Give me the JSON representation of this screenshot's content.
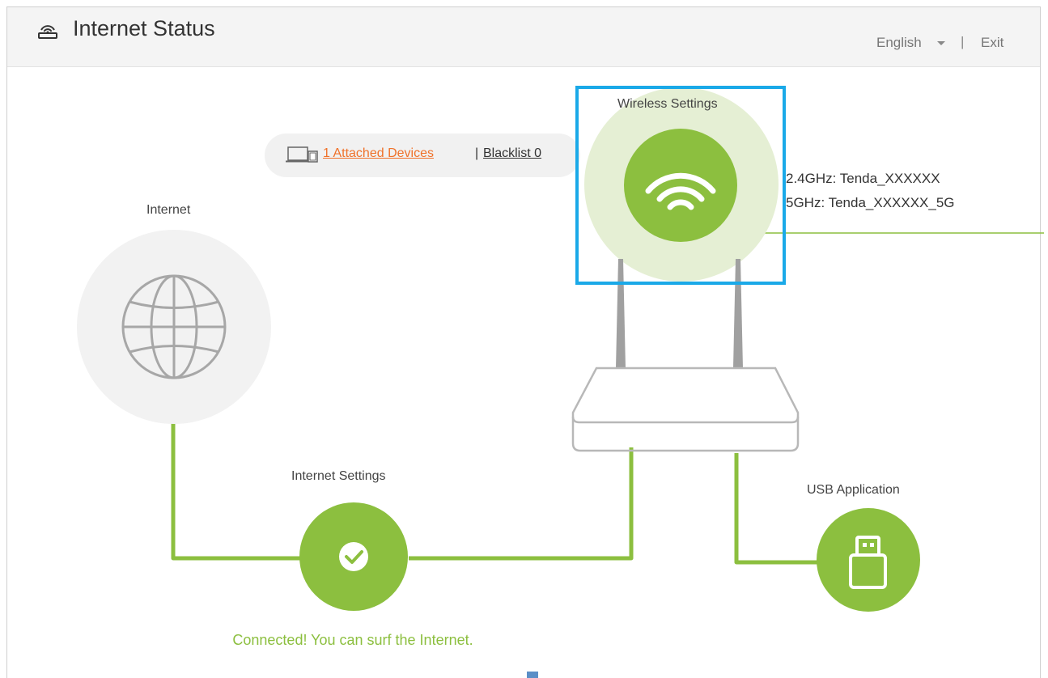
{
  "header": {
    "title": "Internet Status",
    "title_icon": "router-icon",
    "language": "English",
    "separator": "|",
    "exit": "Exit"
  },
  "internet": {
    "label": "Internet",
    "icon": "globe-icon"
  },
  "devices": {
    "attached_link": "1 Attached Devices ",
    "separator": "|",
    "blacklist_link": "Blacklist 0",
    "icon": "devices-icon"
  },
  "wireless": {
    "label": "Wireless Settings",
    "icon": "wifi-icon",
    "ssid_24": "2.4GHz: Tenda_XXXXXX",
    "ssid_5": "5GHz: Tenda_XXXXXX_5G"
  },
  "internet_settings": {
    "label": "Internet Settings",
    "icon": "check-icon",
    "status": "Connected! You can surf the Internet."
  },
  "usb": {
    "label": "USB Application",
    "icon": "usb-drive-icon"
  },
  "colors": {
    "accent_green": "#8cbf3f",
    "light_green": "#e5efd4",
    "link_orange": "#f0722a",
    "highlight_blue": "#1aa9e8",
    "line_gray": "#cccccc"
  }
}
